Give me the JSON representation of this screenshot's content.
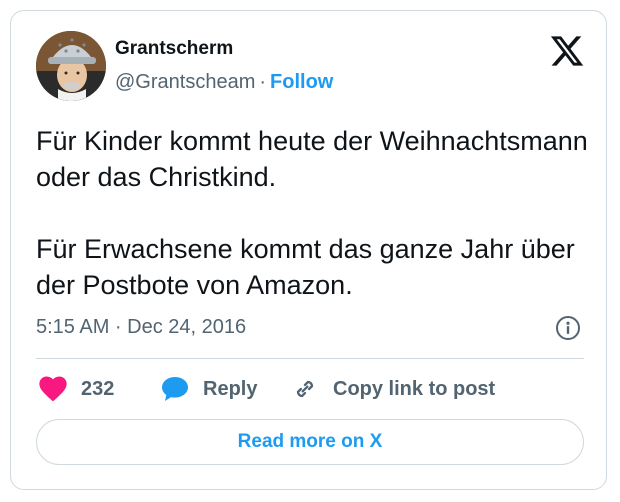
{
  "author": {
    "display_name": "Grantscherm",
    "handle": "@Grantscheam",
    "separator": "·",
    "follow_label": "Follow"
  },
  "tweet": {
    "paragraphs": [
      "Für Kinder kommt heute der Weihnachtsmann oder das Christkind.",
      "Für Erwachsene kommt das ganze Jahr über der Postbote von Amazon."
    ],
    "timestamp": "5:15 AM · Dec 24, 2016"
  },
  "actions": {
    "like_count": "232",
    "reply_label": "Reply",
    "copy_label": "Copy link to post"
  },
  "read_more_label": "Read more on X",
  "icons": {
    "logo": "x-logo-icon",
    "info": "info-icon",
    "like": "heart-icon",
    "reply": "speech-bubble-icon",
    "copy": "link-icon"
  },
  "colors": {
    "accent": "#1d9bf0",
    "like": "#f91880",
    "text": "#0f1419",
    "secondary": "#536471",
    "border": "#cfd9de"
  }
}
